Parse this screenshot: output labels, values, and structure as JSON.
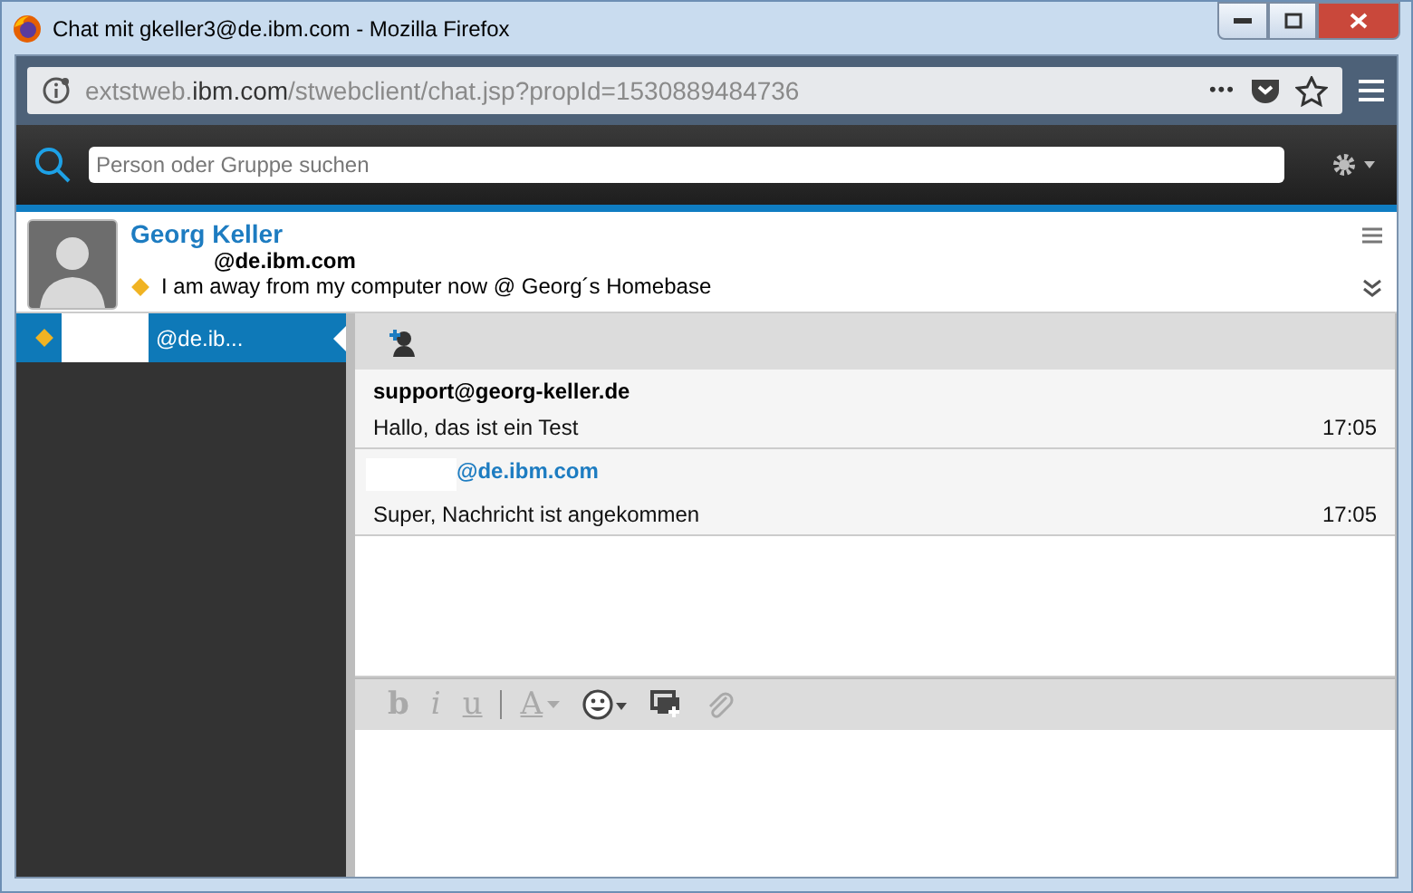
{
  "window": {
    "title": "Chat mit gkeller3@de.ibm.com - Mozilla Firefox"
  },
  "address_bar": {
    "url_prefix": "extstweb.",
    "url_domain": "ibm.com",
    "url_path": "/stwebclient/chat.jsp?propId=1530889484736",
    "more": "•••"
  },
  "search": {
    "placeholder": "Person oder Gruppe suchen"
  },
  "contact": {
    "name": "Georg Keller",
    "email": "@de.ibm.com",
    "color": "#f0b323",
    "status_message": "I am away from my computer now @ Georg´s Homebase"
  },
  "chats": [
    {
      "label": "@de.ib...",
      "color": "#f0b323",
      "selected": true
    }
  ],
  "messages": [
    {
      "kind": "other",
      "sender": "support@georg-keller.de",
      "text": "Hallo, das ist ein Test",
      "time": "17:05"
    },
    {
      "kind": "own",
      "sender": "@de.ibm.com",
      "text": "Super, Nachricht ist angekommen",
      "time": "17:05"
    }
  ],
  "format_tools": [
    {
      "kind": "bold",
      "label": "b",
      "disabled": true
    },
    {
      "kind": "italic",
      "label": "i",
      "disabled": true
    },
    {
      "kind": "underline",
      "label": "u",
      "disabled": true
    },
    {
      "kind": "color",
      "label": "A",
      "disabled": true
    },
    {
      "kind": "emoji",
      "disabled": false
    },
    {
      "kind": "screen",
      "disabled": false
    },
    {
      "kind": "attach",
      "disabled": true
    }
  ]
}
